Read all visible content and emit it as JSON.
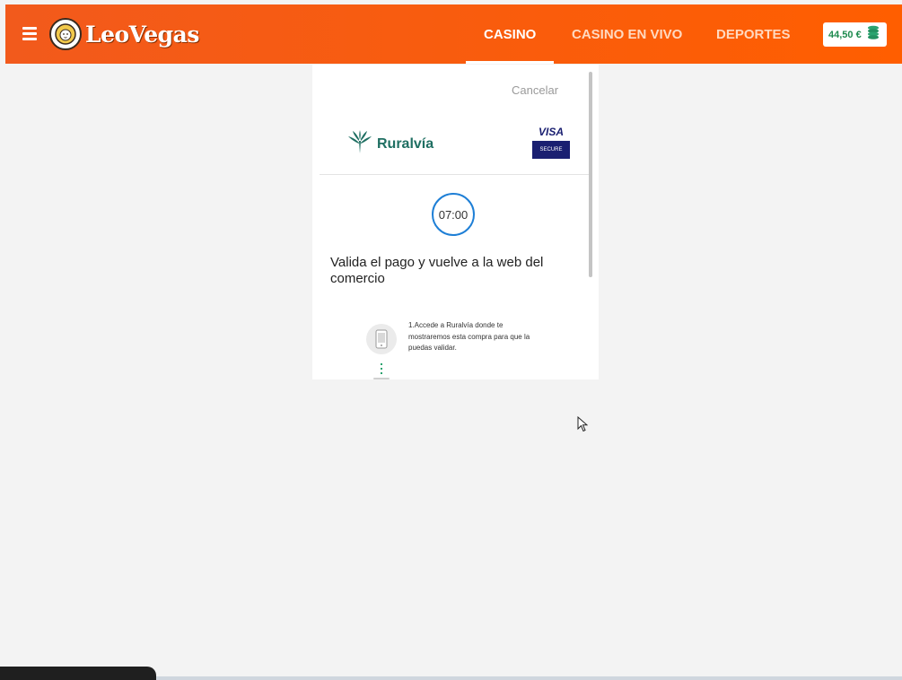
{
  "header": {
    "brand": "LeoVegas",
    "nav": [
      {
        "label": "CASINO",
        "active": true
      },
      {
        "label": "CASINO EN VIVO",
        "active": false
      },
      {
        "label": "DEPORTES",
        "active": false
      }
    ],
    "balance": "44,50 €",
    "accent_color": "#ff5e00"
  },
  "payment": {
    "cancel_label": "Cancelar",
    "bank_name": "Ruralvía",
    "card_brand": "VISA",
    "card_secure": "SECURE",
    "timer": "07:00",
    "heading": "Valida el pago y vuelve a la web del comercio",
    "steps": [
      {
        "text": "1.Accede a Ruralvía donde te mostraremos esta compra para que la puedas validar."
      }
    ]
  }
}
